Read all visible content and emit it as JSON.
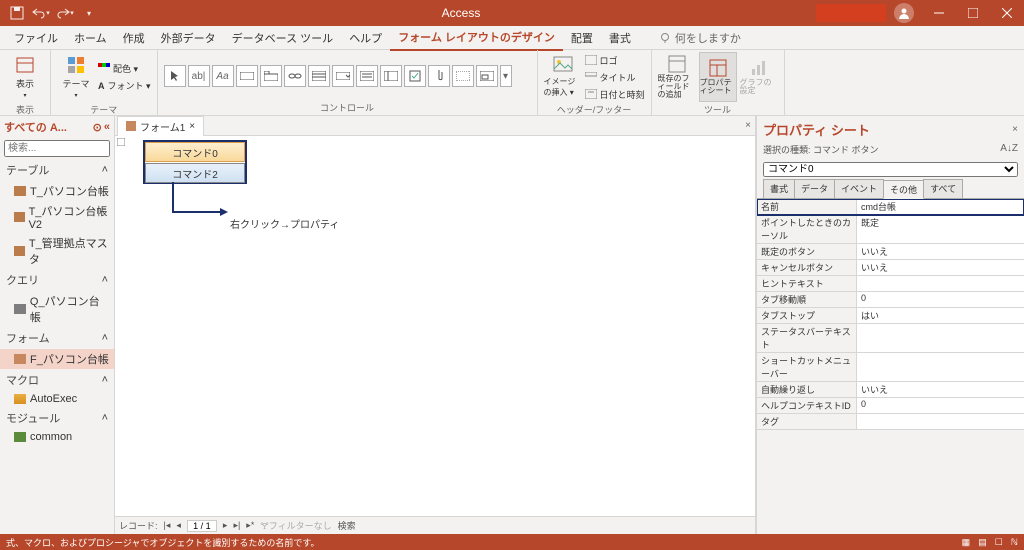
{
  "app_title": "Access",
  "ribbon_tabs": [
    "ファイル",
    "ホーム",
    "作成",
    "外部データ",
    "データベース ツール",
    "ヘルプ",
    "フォーム レイアウトのデザイン",
    "配置",
    "書式"
  ],
  "active_ribbon_tab": 6,
  "tell_me": "何をしますか",
  "groups": {
    "view": {
      "label": "表示",
      "btn": "表示"
    },
    "theme": {
      "label": "テーマ",
      "btn": "テーマ",
      "colors": "配色 ▾",
      "fonts": "フォント ▾"
    },
    "controls": {
      "label": "コントロール"
    },
    "image": {
      "label": "ヘッダー/フッター",
      "btn": "イメージの挿入 ▾",
      "logo": "ロゴ",
      "title": "タイトル",
      "date": "日付と時刻"
    },
    "tools": {
      "label": "ツール",
      "existing": "既存のフィールドの追加",
      "prop": "プロパティシート",
      "chart": "グラフの設定"
    }
  },
  "nav": {
    "title": "すべての A...",
    "search_ph": "検索...",
    "sections": {
      "tables": "テーブル",
      "queries": "クエリ",
      "forms": "フォーム",
      "macros": "マクロ",
      "modules": "モジュール"
    },
    "items": {
      "tables": [
        "T_パソコン台帳",
        "T_パソコン台帳V2",
        "T_管理拠点マスタ"
      ],
      "queries": [
        "Q_パソコン台帳"
      ],
      "forms": [
        "F_パソコン台帳"
      ],
      "macros": [
        "AutoExec"
      ],
      "modules": [
        "common"
      ]
    }
  },
  "doc_tab": "フォーム1",
  "canvas": {
    "ctl0": "コマンド0",
    "ctl2": "コマンド2",
    "annotation": "右クリック→プロパティ"
  },
  "recbar": {
    "label": "レコード:",
    "pos": "1 / 1",
    "filter": "フィルターなし",
    "search": "検索"
  },
  "prop": {
    "title": "プロパティ シート",
    "subtitle": "選択の種類: コマンド ボタン",
    "sort": "A↓Z",
    "combo": "コマンド0",
    "tabs": [
      "書式",
      "データ",
      "イベント",
      "その他",
      "すべて"
    ],
    "active_tab": 3,
    "rows": [
      {
        "k": "名前",
        "v": "cmd台帳"
      },
      {
        "k": "ポイントしたときのカーソル",
        "v": "既定"
      },
      {
        "k": "既定のボタン",
        "v": "いいえ"
      },
      {
        "k": "キャンセルボタン",
        "v": "いいえ"
      },
      {
        "k": "ヒントテキスト",
        "v": ""
      },
      {
        "k": "タブ移動順",
        "v": "0"
      },
      {
        "k": "タブストップ",
        "v": "はい"
      },
      {
        "k": "ステータスバーテキスト",
        "v": ""
      },
      {
        "k": "ショートカットメニューバー",
        "v": ""
      },
      {
        "k": "自動繰り返し",
        "v": "いいえ"
      },
      {
        "k": "ヘルプコンテキストID",
        "v": "0"
      },
      {
        "k": "タグ",
        "v": ""
      }
    ]
  },
  "status": {
    "left": "式、マクロ、およびプロシージャでオブジェクトを識別するための名前です。"
  }
}
